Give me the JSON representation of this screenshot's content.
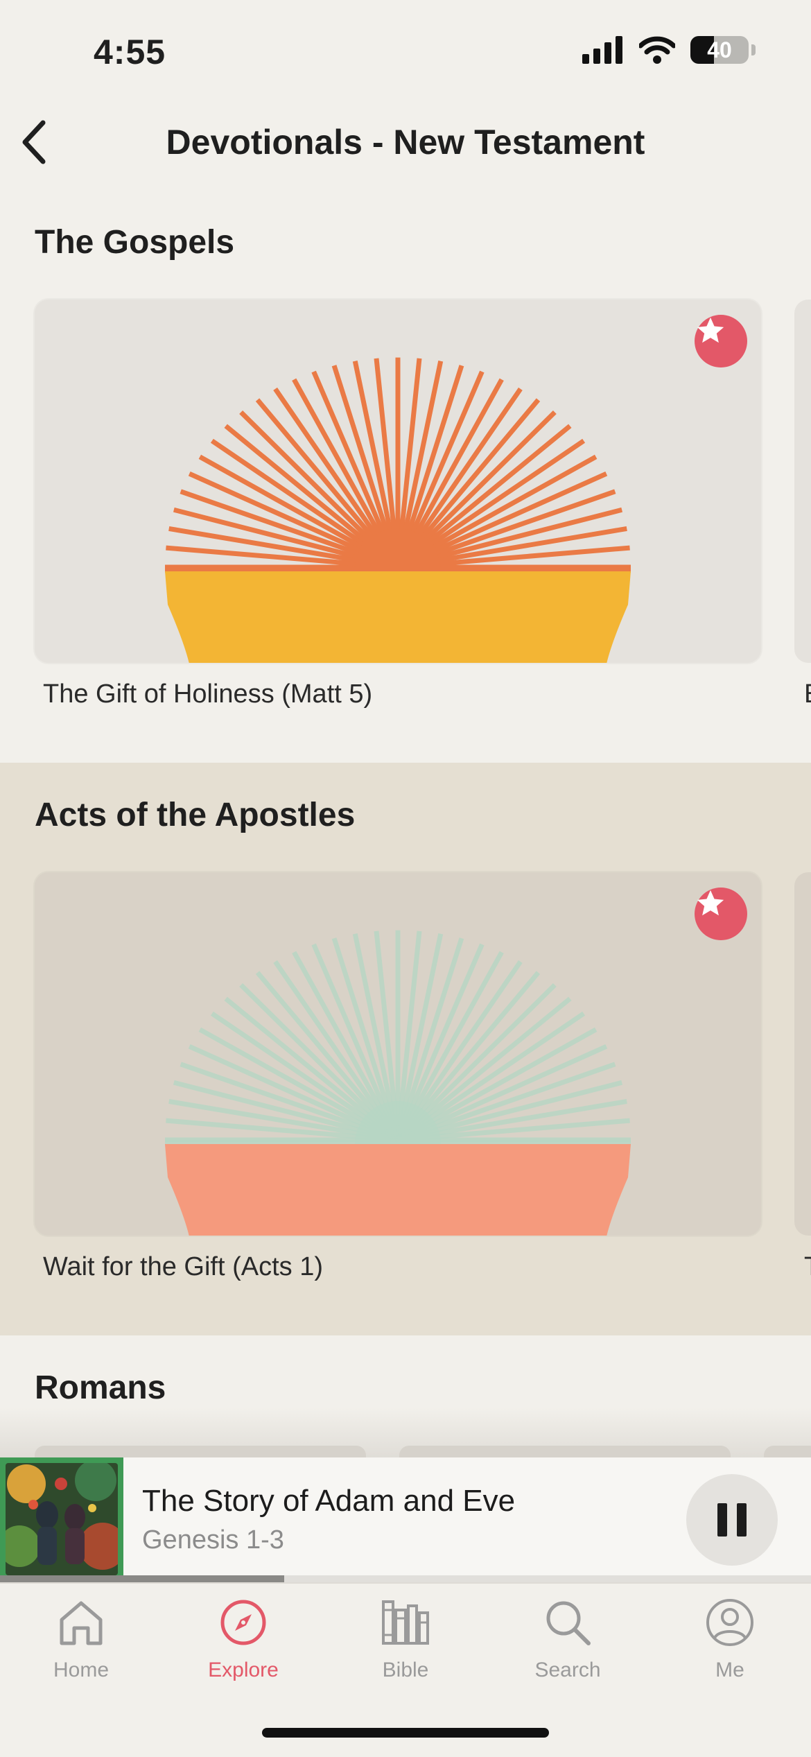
{
  "status_bar": {
    "time": "4:55",
    "battery": "40",
    "battery_level": 0.4
  },
  "header": {
    "title": "Devotionals - New Testament"
  },
  "sections": [
    {
      "title": "The Gospels",
      "cards": [
        {
          "title": "The Gift of Holiness (Matt 5)"
        }
      ],
      "peek_letter": "E"
    },
    {
      "title": "Acts of the Apostles",
      "cards": [
        {
          "title": "Wait for the Gift (Acts 1)"
        }
      ],
      "peek_letter": "T"
    },
    {
      "title": "Romans"
    }
  ],
  "now_playing": {
    "title": "The Story of Adam and Eve",
    "subtitle": "Genesis 1-3",
    "progress": 0.35
  },
  "tabs": [
    {
      "label": "Home",
      "icon": "home-icon",
      "active": false
    },
    {
      "label": "Explore",
      "icon": "compass-icon",
      "active": true
    },
    {
      "label": "Bible",
      "icon": "books-icon",
      "active": false
    },
    {
      "label": "Search",
      "icon": "search-icon",
      "active": false
    },
    {
      "label": "Me",
      "icon": "person-icon",
      "active": false
    }
  ],
  "colors": {
    "accent": "#e35868",
    "background": "#f2f0eb",
    "acts_background": "#e5dfd2",
    "gospels_rays": "#ea7a45",
    "gospels_sand": "#f3b534",
    "acts_rays": "#b7d6c4",
    "acts_sand": "#f59a7d"
  }
}
